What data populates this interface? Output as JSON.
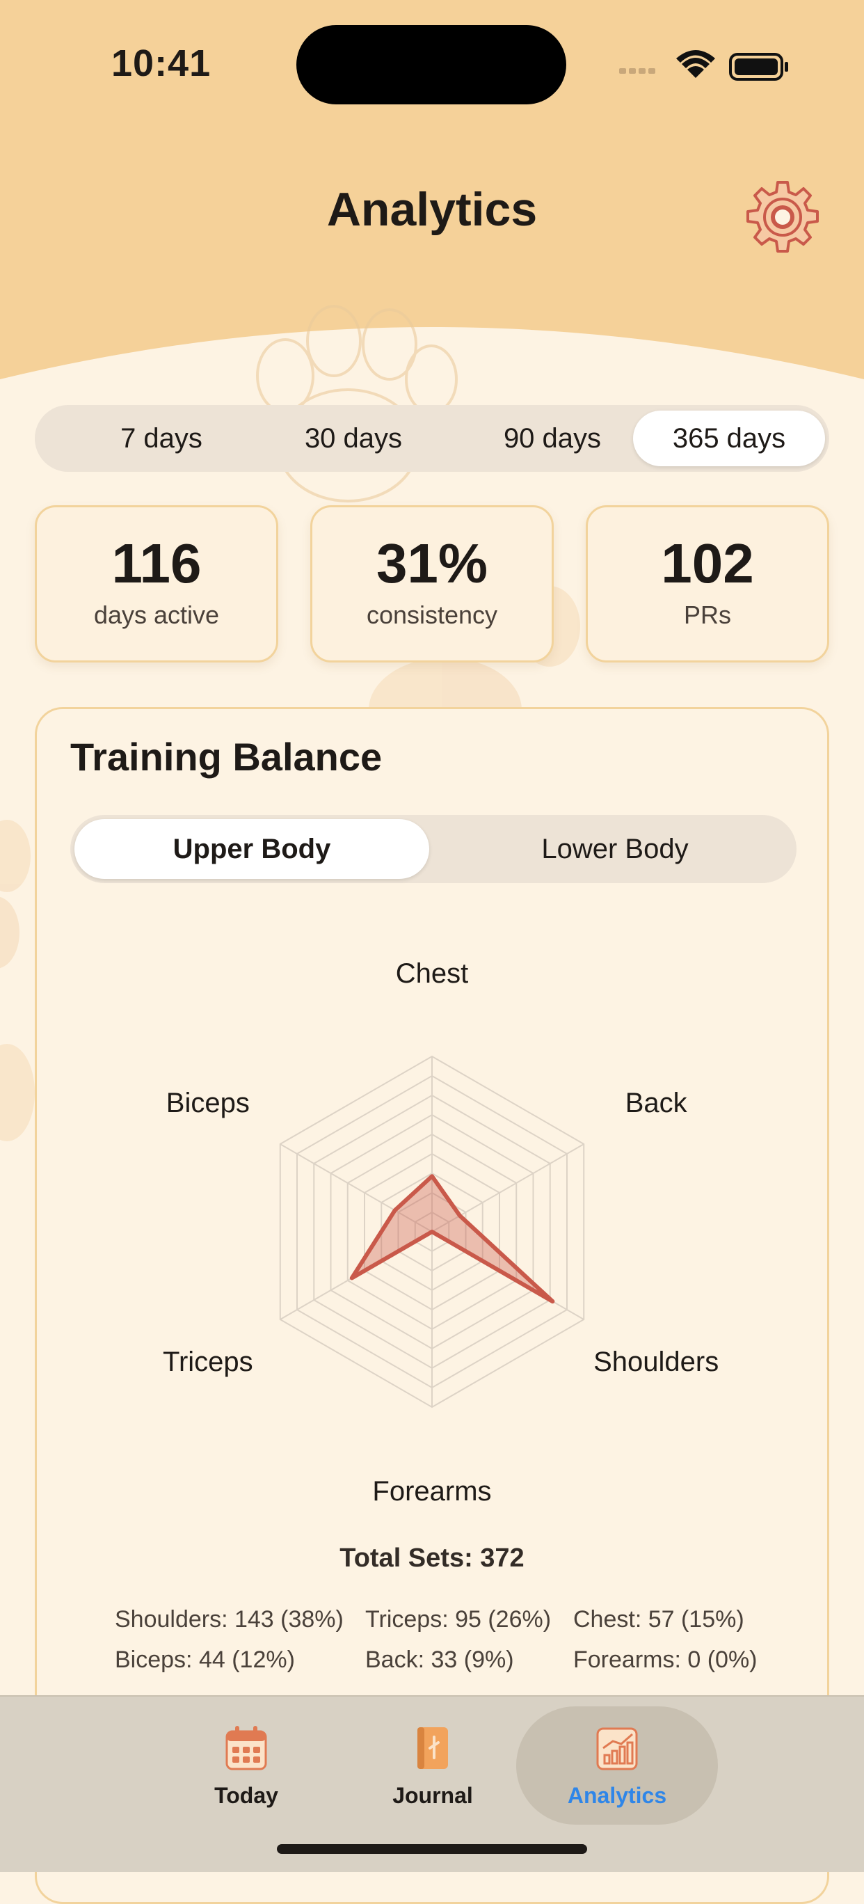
{
  "status_bar": {
    "time": "10:41"
  },
  "header": {
    "title": "Analytics",
    "settings_icon": "gear-icon"
  },
  "range_options": [
    "7 days",
    "30 days",
    "90 days",
    "365 days"
  ],
  "selected_range": "365 days",
  "stats": [
    {
      "value": "116",
      "label": "days active"
    },
    {
      "value": "31%",
      "label": "consistency"
    },
    {
      "value": "102",
      "label": "PRs"
    }
  ],
  "training_balance": {
    "title": "Training Balance",
    "body_options": [
      "Upper Body",
      "Lower Body"
    ],
    "selected_body": "Upper Body"
  },
  "chart_data": {
    "type": "radar",
    "axes": [
      "Chest",
      "Back",
      "Shoulders",
      "Forearms",
      "Triceps",
      "Biceps"
    ],
    "series": [
      {
        "values": [
          57,
          33,
          143,
          0,
          95,
          44
        ]
      }
    ],
    "rlim": [
      0,
      180
    ],
    "rings": 9,
    "fill_color": "#C9594A",
    "grid": true
  },
  "summary": {
    "total_sets": "Total Sets: 372",
    "rows": [
      [
        "Shoulders: 143 (38%)",
        "Triceps: 95 (26%)",
        "Chest: 57 (15%)"
      ],
      [
        "Biceps: 44 (12%)",
        "Back: 33 (9%)",
        "Forearms: 0 (0%)"
      ]
    ]
  },
  "tabs": [
    {
      "label": "Today",
      "icon": "calendar-icon"
    },
    {
      "label": "Journal",
      "icon": "journal-icon"
    },
    {
      "label": "Analytics",
      "icon": "bar-chart-icon"
    }
  ],
  "active_tab": "Analytics",
  "colors": {
    "accent": "#2F86E8",
    "header": "#F5D199",
    "background": "#FDF3E3",
    "card_border": "#F2D39C"
  }
}
